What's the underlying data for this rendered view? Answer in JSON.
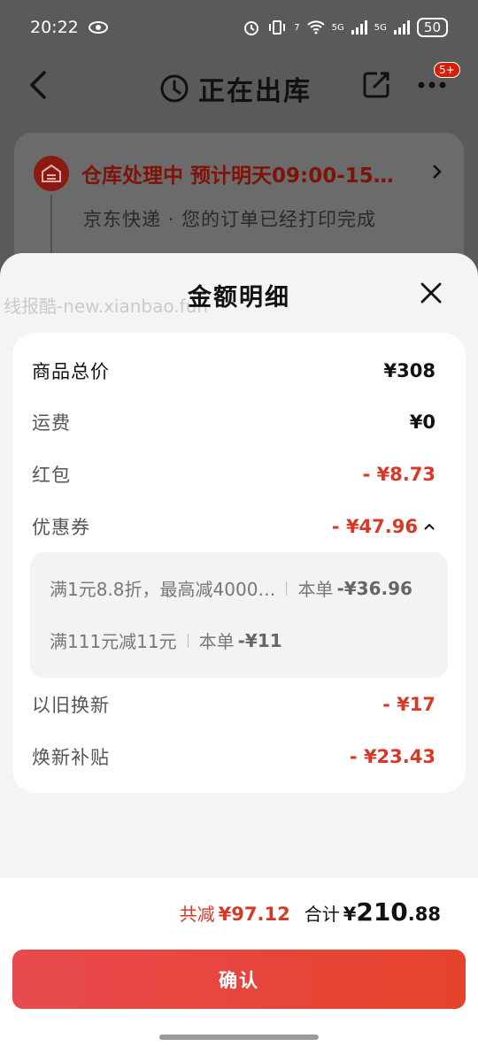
{
  "status_bar": {
    "time": "20:22",
    "network_1": "5G",
    "network_2": "5G",
    "wifi_level": "7",
    "battery": "50"
  },
  "nav": {
    "title": "正在出库",
    "badge": "5+"
  },
  "warehouse": {
    "status": "仓库处理中",
    "eta": "预计明天09:00-15…",
    "subtitle": "京东快递 · 您的订单已经打印完成"
  },
  "sheet": {
    "title": "金额明细",
    "watermark": "线报酷-new.xianbao.fun",
    "rows": [
      {
        "label": "商品总价",
        "amount": "¥308"
      },
      {
        "label": "运费",
        "amount": "¥0"
      },
      {
        "label": "红包",
        "amount": "- ¥8.73"
      },
      {
        "label": "优惠券",
        "amount": "- ¥47.96"
      },
      {
        "label": "以旧换新",
        "amount": "- ¥17"
      },
      {
        "label": "焕新补贴",
        "amount": "- ¥23.43"
      }
    ],
    "coupons": [
      {
        "name": "满1元8.8折，最高减4000…",
        "scope": "本单",
        "discount": "-¥36.96"
      },
      {
        "name": "满111元减11元",
        "scope": "本单",
        "discount": "-¥11"
      }
    ]
  },
  "footer": {
    "saved_label": "共减",
    "saved_value": "¥97.12",
    "total_label": "合计",
    "total_currency": "¥",
    "total_integer": "210",
    "total_decimal": ".88",
    "confirm_label": "确认"
  },
  "colors": {
    "accent_red": "#d63a26",
    "button_gradient_start": "#e84a4e",
    "button_gradient_end": "#e5432b"
  },
  "icons": [
    "clock-icon",
    "share-icon",
    "more-icon",
    "warehouse-icon",
    "close-icon",
    "chevron-up-icon",
    "chevron-right-icon",
    "back-icon"
  ]
}
